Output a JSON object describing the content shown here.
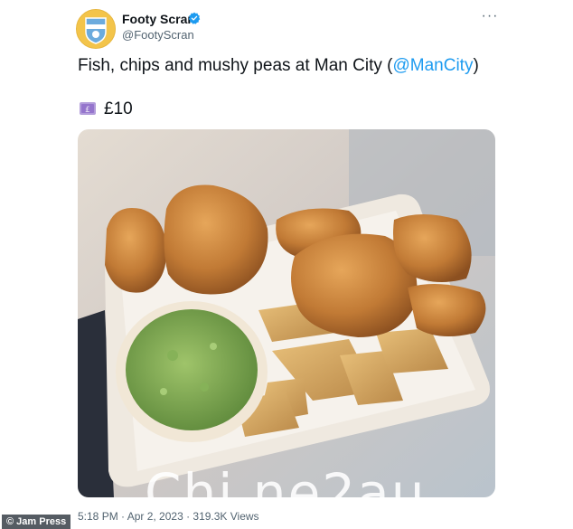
{
  "tweet": {
    "author": {
      "display_name": "Footy Scran",
      "handle": "@FootyScran",
      "verified": true
    },
    "more_icon": "ellipsis-icon",
    "text_prefix": "Fish, chips and mushy peas at Man City (",
    "mention": "@ManCity",
    "text_suffix": ")",
    "price_emoji": "money-with-wings-icon",
    "price": "£10",
    "meta": "5:18 PM · Apr 2, 2023 · 319.3K Views"
  },
  "overlay": {
    "watermark": "Chi  ne2au",
    "photo_credit": "© Jam Press"
  },
  "colors": {
    "mention": "#1d9bf0",
    "verified": "#1d9bf0",
    "secondary_text": "#536471"
  }
}
